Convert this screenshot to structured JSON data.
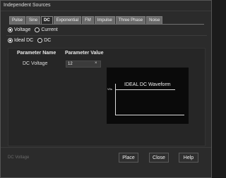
{
  "window": {
    "title": "Independent Sources"
  },
  "tabs": [
    {
      "label": "Pulse"
    },
    {
      "label": "Sine"
    },
    {
      "label": "DC"
    },
    {
      "label": "Exponential"
    },
    {
      "label": "FM"
    },
    {
      "label": "Impulse"
    },
    {
      "label": "Three Phase"
    },
    {
      "label": "Noise"
    }
  ],
  "active_tab": "DC",
  "source_type": {
    "voltage_label": "Voltage",
    "current_label": "Current",
    "selected": "Voltage"
  },
  "dc_mode": {
    "ideal_label": "Ideal DC",
    "dc_label": "DC",
    "selected": "Ideal DC"
  },
  "table": {
    "col_name": "Parameter Name",
    "col_value": "Parameter Value",
    "rows": [
      {
        "name": "DC Voltage",
        "value": "12"
      }
    ]
  },
  "input": {
    "clear_glyph": "×"
  },
  "waveform": {
    "title": "IDEAL DC Waveform",
    "y_label": "V0s"
  },
  "status_text": "DC Voltage",
  "buttons": {
    "place": "Place",
    "close": "Close",
    "help": "Help"
  }
}
